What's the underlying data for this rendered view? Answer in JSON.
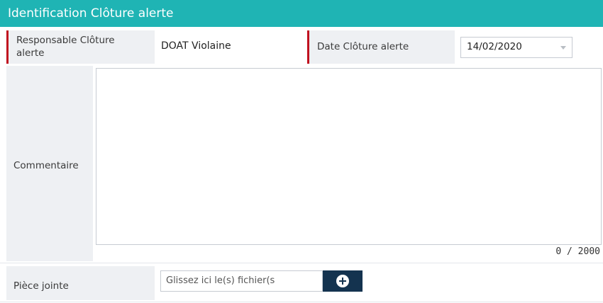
{
  "section": {
    "title": "Identification Clôture alerte"
  },
  "fields": {
    "responsable_label": "Responsable Clôture alerte",
    "responsable_value": "DOAT Violaine",
    "date_label": "Date Clôture alerte",
    "date_value": "14/02/2020",
    "commentaire_label": "Commentaire",
    "commentaire_counter": "0 / 2000",
    "piece_jointe_label": "Pièce jointe",
    "file_placeholder": "Glissez ici le(s) fichier(s"
  },
  "colors": {
    "header_bg": "#1fb4b4",
    "required_marker": "#c0111f",
    "add_button_bg": "#14334f",
    "label_bg": "#eef0f3"
  },
  "icons": {
    "add_file": "plus-circle-icon",
    "date_dropdown": "chevron-down-icon"
  }
}
